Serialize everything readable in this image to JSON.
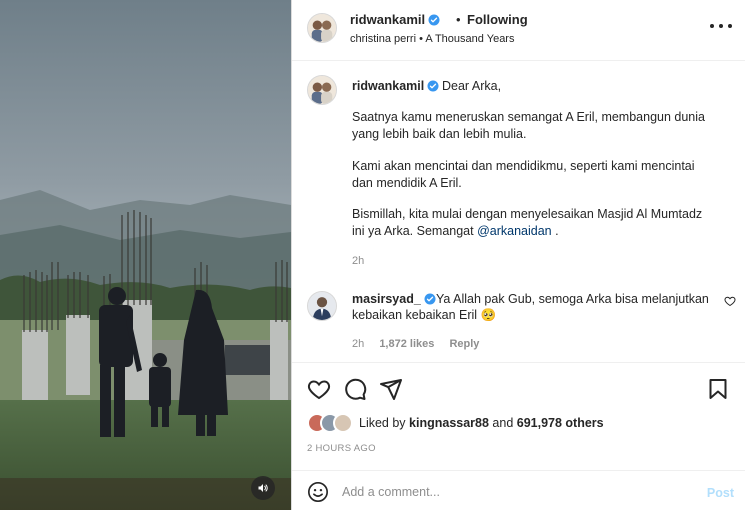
{
  "post": {
    "username": "ridwankamil",
    "follow_status": "Following",
    "audio": "christina perri • A Thousand Years"
  },
  "caption": {
    "username": "ridwankamil",
    "first_line": "Dear Arka,",
    "para1_line1": "Saatnya kamu meneruskan semangat A Eril, membangun dunia",
    "para1_line2": "yang lebih baik dan lebih mulia.",
    "para2_line1": "Kami akan mencintai dan mendidikmu, seperti kami mencintai",
    "para2_line2": "dan mendidik A Eril.",
    "para3_line1": "Bismillah, kita mulai dengan menyelesaikan Masjid Al Mumtadz",
    "para3_prefix": "ini ya Arka. Semangat ",
    "mention": "@arkanaidan",
    "para3_suffix": " .",
    "time": "2h"
  },
  "reply": {
    "username": "masirsyad_",
    "text_line1": "Ya Allah pak Gub, semoga Arka bisa melanjutkan",
    "text_line2": "kebaikan kebaikan Eril 🥺",
    "time": "2h",
    "likes": "1,872 likes",
    "reply_label": "Reply"
  },
  "likes": {
    "prefix": "Liked by ",
    "user": "kingnassar88",
    "middle": " and ",
    "count": "691,978 others"
  },
  "timestamp": "2 HOURS AGO",
  "composer": {
    "placeholder": "Add a comment...",
    "post_label": "Post"
  },
  "colors": {
    "verified": "#3897f0",
    "link": "#00376b",
    "post_disabled": "#b2dffc",
    "muted": "#8e8e8e"
  },
  "icons": [
    "volume-icon",
    "verified-icon",
    "more-icon",
    "heart-icon",
    "comment-icon",
    "share-icon",
    "bookmark-icon",
    "emoji-icon"
  ]
}
